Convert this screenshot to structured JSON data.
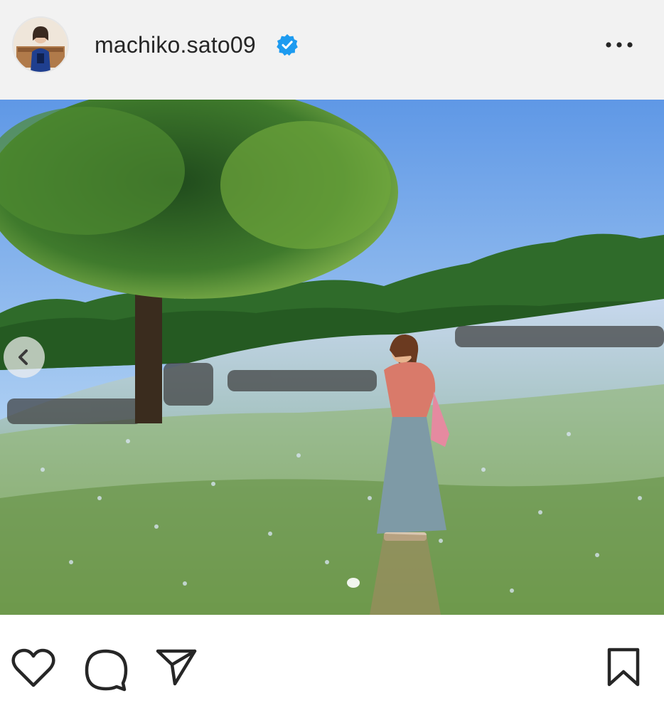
{
  "post": {
    "username": "machiko.sato09",
    "verified": true,
    "verified_icon": "verified-badge-icon",
    "more_icon": "more-horizontal-icon"
  },
  "photo": {
    "description_icons": {
      "prev": "chevron-left-icon",
      "indicator": "carousel-dot"
    },
    "carousel_total": 1,
    "carousel_index": 1
  },
  "actions": {
    "like_icon": "heart-icon",
    "comment_icon": "comment-icon",
    "share_icon": "send-icon",
    "save_icon": "bookmark-icon"
  },
  "colors": {
    "verified": "#1d9bf0",
    "header_bg": "#f2f2f2",
    "icon": "#262626"
  }
}
